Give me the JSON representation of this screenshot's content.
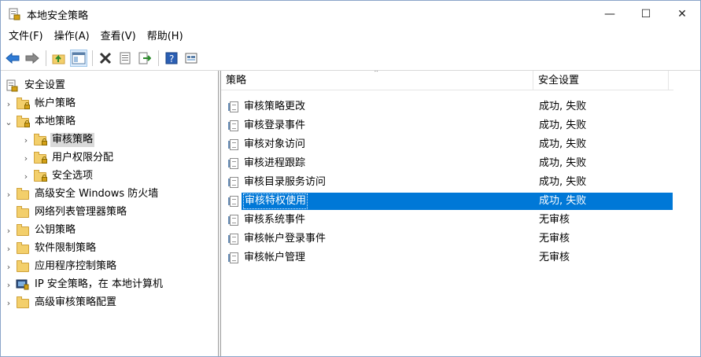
{
  "window": {
    "title": "本地安全策略",
    "minimize": "—",
    "maximize": "☐",
    "close": "✕"
  },
  "menu": [
    "文件(F)",
    "操作(A)",
    "查看(V)",
    "帮助(H)"
  ],
  "toolbar": {
    "icons": [
      "back-arrow-icon",
      "forward-arrow-icon",
      "up-folder-icon",
      "show-hide-tree-icon",
      "delete-icon",
      "properties-icon",
      "export-list-icon",
      "help-icon",
      "view-icon"
    ]
  },
  "tree": {
    "root": "安全设置",
    "items": [
      {
        "label": "帐户策略",
        "expander": "›"
      },
      {
        "label": "本地策略",
        "expander": "⌄"
      },
      {
        "label": "审核策略",
        "expander": "›",
        "selected": true
      },
      {
        "label": "用户权限分配",
        "expander": "›"
      },
      {
        "label": "安全选项",
        "expander": "›"
      },
      {
        "label": "高级安全 Windows 防火墙",
        "expander": "›"
      },
      {
        "label": "网络列表管理器策略",
        "expander": ""
      },
      {
        "label": "公钥策略",
        "expander": "›"
      },
      {
        "label": "软件限制策略",
        "expander": "›"
      },
      {
        "label": "应用程序控制策略",
        "expander": "›"
      },
      {
        "label": "IP 安全策略，在 本地计算机",
        "expander": "›"
      },
      {
        "label": "高级审核策略配置",
        "expander": "›"
      }
    ]
  },
  "list": {
    "columns": [
      "策略",
      "安全设置"
    ],
    "sort_caret": "⌃",
    "rows": [
      {
        "policy": "审核策略更改",
        "setting": "成功, 失败"
      },
      {
        "policy": "审核登录事件",
        "setting": "成功, 失败"
      },
      {
        "policy": "审核对象访问",
        "setting": "成功, 失败"
      },
      {
        "policy": "审核进程跟踪",
        "setting": "成功, 失败"
      },
      {
        "policy": "审核目录服务访问",
        "setting": "成功, 失败"
      },
      {
        "policy": "审核特权使用",
        "setting": "成功, 失败",
        "selected": true
      },
      {
        "policy": "审核系统事件",
        "setting": "无审核"
      },
      {
        "policy": "审核帐户登录事件",
        "setting": "无审核"
      },
      {
        "policy": "审核帐户管理",
        "setting": "无审核"
      }
    ]
  },
  "colors": {
    "selection": "#0078d7",
    "tree_selection": "#d9d9d9",
    "folder": "#f3cf6b"
  }
}
